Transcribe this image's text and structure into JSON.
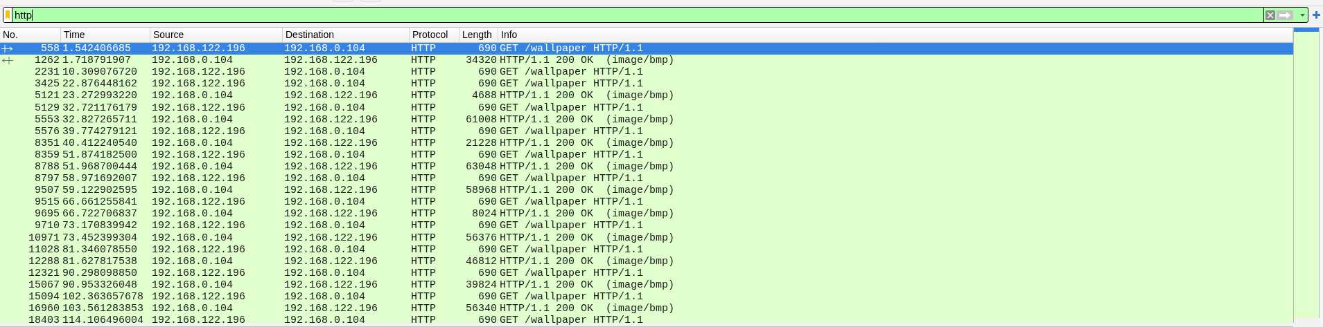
{
  "display_filter": {
    "value": "http"
  },
  "columns": [
    "No.",
    "Time",
    "Source",
    "Destination",
    "Protocol",
    "Length",
    "Info"
  ],
  "packets": [
    {
      "no": "558",
      "time": "1.542406685",
      "source": "192.168.122.196",
      "destination": "192.168.0.104",
      "protocol": "HTTP",
      "length": "690",
      "info": "GET /wallpaper HTTP/1.1",
      "selected": true,
      "kind": "request"
    },
    {
      "no": "1262",
      "time": "1.718791907",
      "source": "192.168.0.104",
      "destination": "192.168.122.196",
      "protocol": "HTTP",
      "length": "34320",
      "info": "HTTP/1.1 200 OK  (image/bmp)",
      "selected": false,
      "kind": "response"
    },
    {
      "no": "2231",
      "time": "10.309076720",
      "source": "192.168.122.196",
      "destination": "192.168.0.104",
      "protocol": "HTTP",
      "length": "690",
      "info": "GET /wallpaper HTTP/1.1",
      "selected": false,
      "kind": "plain"
    },
    {
      "no": "3425",
      "time": "22.876448162",
      "source": "192.168.122.196",
      "destination": "192.168.0.104",
      "protocol": "HTTP",
      "length": "690",
      "info": "GET /wallpaper HTTP/1.1",
      "selected": false,
      "kind": "plain"
    },
    {
      "no": "5121",
      "time": "23.272993220",
      "source": "192.168.0.104",
      "destination": "192.168.122.196",
      "protocol": "HTTP",
      "length": "4688",
      "info": "HTTP/1.1 200 OK  (image/bmp)",
      "selected": false,
      "kind": "plain"
    },
    {
      "no": "5129",
      "time": "32.721176179",
      "source": "192.168.122.196",
      "destination": "192.168.0.104",
      "protocol": "HTTP",
      "length": "690",
      "info": "GET /wallpaper HTTP/1.1",
      "selected": false,
      "kind": "plain"
    },
    {
      "no": "5553",
      "time": "32.827265711",
      "source": "192.168.0.104",
      "destination": "192.168.122.196",
      "protocol": "HTTP",
      "length": "61008",
      "info": "HTTP/1.1 200 OK  (image/bmp)",
      "selected": false,
      "kind": "plain"
    },
    {
      "no": "5576",
      "time": "39.774279121",
      "source": "192.168.122.196",
      "destination": "192.168.0.104",
      "protocol": "HTTP",
      "length": "690",
      "info": "GET /wallpaper HTTP/1.1",
      "selected": false,
      "kind": "plain"
    },
    {
      "no": "8351",
      "time": "40.412240540",
      "source": "192.168.0.104",
      "destination": "192.168.122.196",
      "protocol": "HTTP",
      "length": "21228",
      "info": "HTTP/1.1 200 OK  (image/bmp)",
      "selected": false,
      "kind": "plain"
    },
    {
      "no": "8359",
      "time": "51.874182500",
      "source": "192.168.122.196",
      "destination": "192.168.0.104",
      "protocol": "HTTP",
      "length": "690",
      "info": "GET /wallpaper HTTP/1.1",
      "selected": false,
      "kind": "plain"
    },
    {
      "no": "8788",
      "time": "51.968700444",
      "source": "192.168.0.104",
      "destination": "192.168.122.196",
      "protocol": "HTTP",
      "length": "63048",
      "info": "HTTP/1.1 200 OK  (image/bmp)",
      "selected": false,
      "kind": "plain"
    },
    {
      "no": "8797",
      "time": "58.971692007",
      "source": "192.168.122.196",
      "destination": "192.168.0.104",
      "protocol": "HTTP",
      "length": "690",
      "info": "GET /wallpaper HTTP/1.1",
      "selected": false,
      "kind": "plain"
    },
    {
      "no": "9507",
      "time": "59.122902595",
      "source": "192.168.0.104",
      "destination": "192.168.122.196",
      "protocol": "HTTP",
      "length": "58968",
      "info": "HTTP/1.1 200 OK  (image/bmp)",
      "selected": false,
      "kind": "plain"
    },
    {
      "no": "9515",
      "time": "66.661255841",
      "source": "192.168.122.196",
      "destination": "192.168.0.104",
      "protocol": "HTTP",
      "length": "690",
      "info": "GET /wallpaper HTTP/1.1",
      "selected": false,
      "kind": "plain"
    },
    {
      "no": "9695",
      "time": "66.722706837",
      "source": "192.168.0.104",
      "destination": "192.168.122.196",
      "protocol": "HTTP",
      "length": "8024",
      "info": "HTTP/1.1 200 OK  (image/bmp)",
      "selected": false,
      "kind": "plain"
    },
    {
      "no": "9710",
      "time": "73.170839942",
      "source": "192.168.122.196",
      "destination": "192.168.0.104",
      "protocol": "HTTP",
      "length": "690",
      "info": "GET /wallpaper HTTP/1.1",
      "selected": false,
      "kind": "plain"
    },
    {
      "no": "10971",
      "time": "73.452399304",
      "source": "192.168.0.104",
      "destination": "192.168.122.196",
      "protocol": "HTTP",
      "length": "56376",
      "info": "HTTP/1.1 200 OK  (image/bmp)",
      "selected": false,
      "kind": "plain"
    },
    {
      "no": "11028",
      "time": "81.346078550",
      "source": "192.168.122.196",
      "destination": "192.168.0.104",
      "protocol": "HTTP",
      "length": "690",
      "info": "GET /wallpaper HTTP/1.1",
      "selected": false,
      "kind": "plain"
    },
    {
      "no": "12288",
      "time": "81.627817538",
      "source": "192.168.0.104",
      "destination": "192.168.122.196",
      "protocol": "HTTP",
      "length": "46812",
      "info": "HTTP/1.1 200 OK  (image/bmp)",
      "selected": false,
      "kind": "plain"
    },
    {
      "no": "12321",
      "time": "90.298098850",
      "source": "192.168.122.196",
      "destination": "192.168.0.104",
      "protocol": "HTTP",
      "length": "690",
      "info": "GET /wallpaper HTTP/1.1",
      "selected": false,
      "kind": "plain"
    },
    {
      "no": "15067",
      "time": "90.953326048",
      "source": "192.168.0.104",
      "destination": "192.168.122.196",
      "protocol": "HTTP",
      "length": "39824",
      "info": "HTTP/1.1 200 OK  (image/bmp)",
      "selected": false,
      "kind": "plain"
    },
    {
      "no": "15094",
      "time": "102.363657678",
      "source": "192.168.122.196",
      "destination": "192.168.0.104",
      "protocol": "HTTP",
      "length": "690",
      "info": "GET /wallpaper HTTP/1.1",
      "selected": false,
      "kind": "plain"
    },
    {
      "no": "16960",
      "time": "103.561283853",
      "source": "192.168.0.104",
      "destination": "192.168.122.196",
      "protocol": "HTTP",
      "length": "56340",
      "info": "HTTP/1.1 200 OK  (image/bmp)",
      "selected": false,
      "kind": "plain"
    },
    {
      "no": "18403",
      "time": "114.106496004",
      "source": "192.168.122.196",
      "destination": "192.168.0.104",
      "protocol": "HTTP",
      "length": "690",
      "info": "GET /wallpaper HTTP/1.1",
      "selected": false,
      "kind": "plain"
    }
  ]
}
